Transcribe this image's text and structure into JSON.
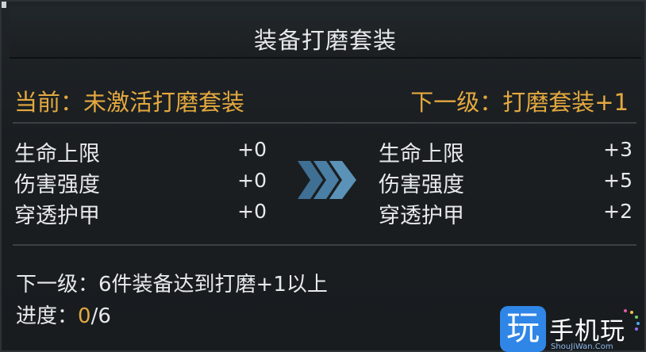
{
  "panel": {
    "title": "装备打磨套装",
    "current_label": "当前：",
    "current_value": "未激活打磨套装",
    "next_label": "下一级：",
    "next_value": "打磨套装+1"
  },
  "current_stats": [
    {
      "name": "生命上限",
      "value": "+0"
    },
    {
      "name": "伤害强度",
      "value": "+0"
    },
    {
      "name": "穿透护甲",
      "value": "+0"
    }
  ],
  "next_stats": [
    {
      "name": "生命上限",
      "value": "+3"
    },
    {
      "name": "伤害强度",
      "value": "+5"
    },
    {
      "name": "穿透护甲",
      "value": "+2"
    }
  ],
  "requirement": {
    "label": "下一级：",
    "text": "6件装备达到打磨+1以上"
  },
  "progress": {
    "label": "进度：",
    "current": "0",
    "total": "/6"
  },
  "watermark": {
    "logo_char": "玩",
    "brand": "手机玩",
    "url": "ShouJiWan.Com"
  },
  "colors": {
    "accent": "#e4a93f",
    "text": "#e7e9ea",
    "background": "#1a1e21",
    "arrow": "#3f6f93",
    "watermark_blue": "#2f86e6"
  },
  "icons": {
    "transition": "chevron-right-triple-icon",
    "watermark_logo": "play-logo-icon"
  }
}
